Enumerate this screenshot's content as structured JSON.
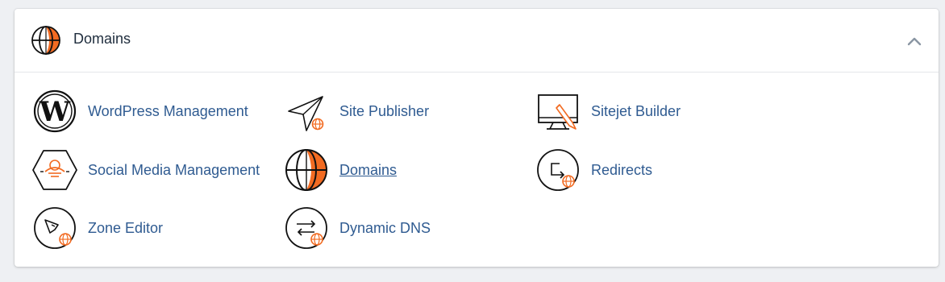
{
  "header": {
    "title": "Domains",
    "icon": "globe-icon",
    "collapse_icon": "chevron-up-icon"
  },
  "items": [
    {
      "label": "WordPress Management",
      "icon": "wordpress-icon"
    },
    {
      "label": "Site Publisher",
      "icon": "paper-plane-icon"
    },
    {
      "label": "Sitejet Builder",
      "icon": "monitor-pencil-icon"
    },
    {
      "label": "Social Media Management",
      "icon": "social-media-icon"
    },
    {
      "label": "Domains",
      "icon": "globe-icon",
      "active": true
    },
    {
      "label": "Redirects",
      "icon": "redirect-icon"
    },
    {
      "label": "Zone Editor",
      "icon": "zone-editor-icon"
    },
    {
      "label": "Dynamic DNS",
      "icon": "dynamic-dns-icon"
    }
  ],
  "colors": {
    "accent": "#f26b22",
    "link": "#2f5b91",
    "title": "#1f2d3d"
  }
}
